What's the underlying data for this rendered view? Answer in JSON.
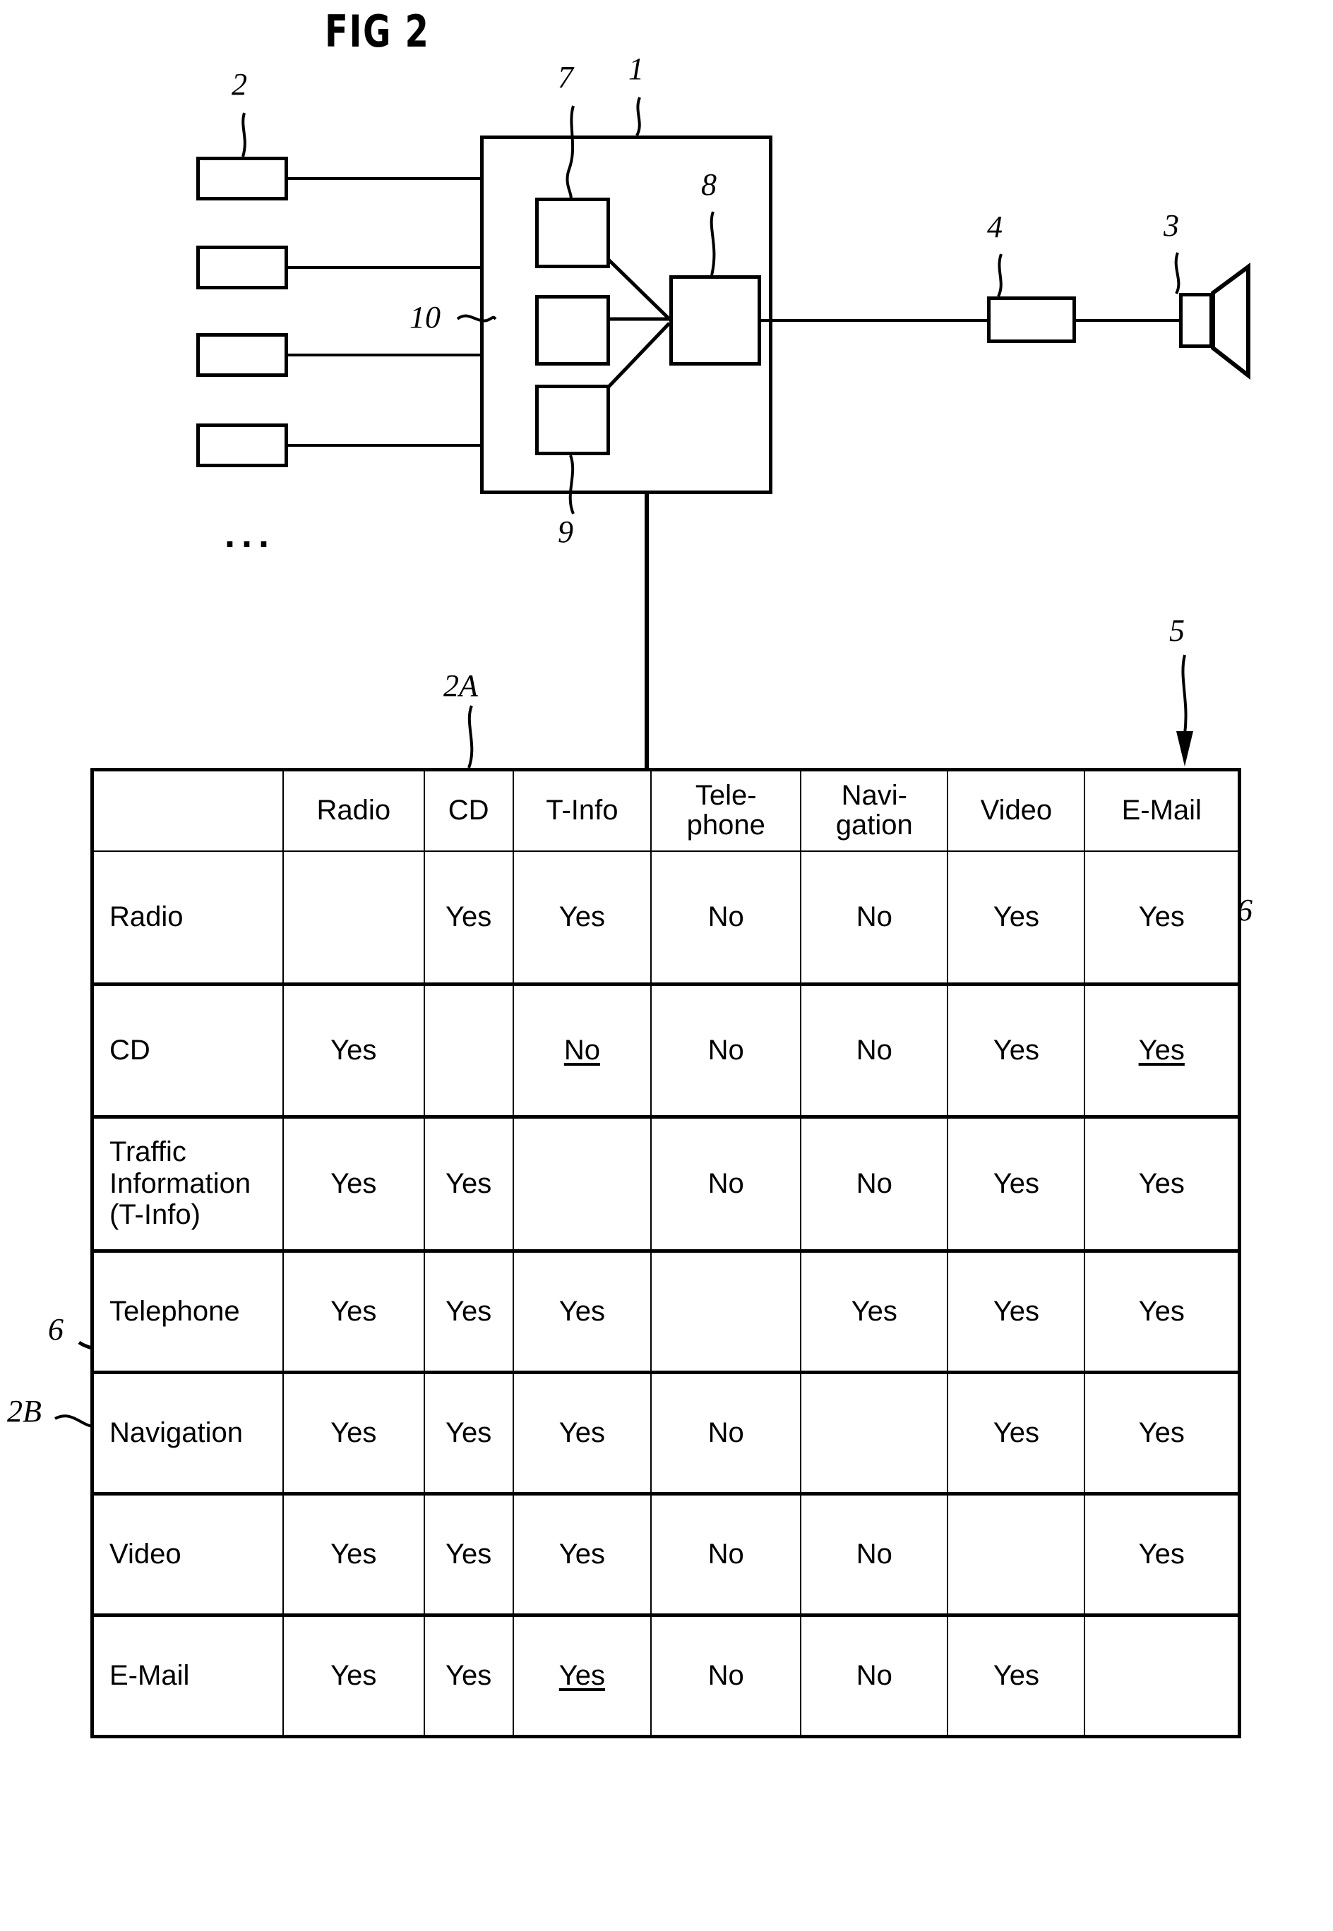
{
  "figure": {
    "title": "FIG 2",
    "ellipsis": "..."
  },
  "block_diagram": {
    "refs": {
      "sources": "2",
      "main_unit": "1",
      "decoder_top": "7",
      "mixer": "8",
      "decoder_bottom": "9",
      "bus": "10",
      "amplifier": "4",
      "loudspeaker": "3"
    },
    "source_boxes": [
      "",
      "",
      "",
      ""
    ],
    "inner_boxes": [
      "",
      "",
      ""
    ],
    "mixer_box": "",
    "amplifier_box": "",
    "speaker_box": ""
  },
  "matrix": {
    "refs": {
      "columns_group": "2A",
      "rows_group": "2B",
      "arrow_to_email": "5",
      "cell_note_radio_email": "6",
      "cell_note_telephone_cd": "6"
    },
    "corner_header": "",
    "columns": [
      "Radio",
      "CD",
      "T-Info",
      "Tele-\nphone",
      "Navi-\ngation",
      "Video",
      "E-Mail"
    ],
    "column_labels": {
      "radio": "Radio",
      "cd": "CD",
      "tinfo": "T-Info",
      "telephone_line1": "Tele-",
      "telephone_line2": "phone",
      "navigation_line1": "Navi-",
      "navigation_line2": "gation",
      "video": "Video",
      "email": "E-Mail"
    },
    "row_labels": {
      "radio": "Radio",
      "cd": "CD",
      "tinfo_line1": "Traffic",
      "tinfo_line2": "Information",
      "tinfo_line3": "(T-Info)",
      "telephone": "Telephone",
      "navigation": "Navigation",
      "video": "Video",
      "email": "E-Mail"
    },
    "rows": [
      {
        "label": "Radio",
        "cells": [
          {
            "v": ""
          },
          {
            "v": "Yes"
          },
          {
            "v": "Yes"
          },
          {
            "v": "No"
          },
          {
            "v": "No"
          },
          {
            "v": "Yes"
          },
          {
            "v": "Yes"
          }
        ]
      },
      {
        "label": "CD",
        "cells": [
          {
            "v": "Yes"
          },
          {
            "v": ""
          },
          {
            "v": "No",
            "underline": true
          },
          {
            "v": "No"
          },
          {
            "v": "No"
          },
          {
            "v": "Yes"
          },
          {
            "v": "Yes",
            "underline": true
          }
        ]
      },
      {
        "label": "Traffic Information (T-Info)",
        "cells": [
          {
            "v": "Yes"
          },
          {
            "v": "Yes"
          },
          {
            "v": ""
          },
          {
            "v": "No"
          },
          {
            "v": "No"
          },
          {
            "v": "Yes"
          },
          {
            "v": "Yes"
          }
        ]
      },
      {
        "label": "Telephone",
        "cells": [
          {
            "v": "Yes"
          },
          {
            "v": "Yes",
            "circled": true
          },
          {
            "v": "Yes"
          },
          {
            "v": ""
          },
          {
            "v": "Yes"
          },
          {
            "v": "Yes"
          },
          {
            "v": "Yes"
          }
        ]
      },
      {
        "label": "Navigation",
        "cells": [
          {
            "v": "Yes"
          },
          {
            "v": "Yes"
          },
          {
            "v": "Yes"
          },
          {
            "v": "No"
          },
          {
            "v": ""
          },
          {
            "v": "Yes"
          },
          {
            "v": "Yes"
          }
        ]
      },
      {
        "label": "Video",
        "cells": [
          {
            "v": "Yes"
          },
          {
            "v": "Yes"
          },
          {
            "v": "Yes"
          },
          {
            "v": "No"
          },
          {
            "v": "No"
          },
          {
            "v": ""
          },
          {
            "v": "Yes"
          }
        ]
      },
      {
        "label": "E-Mail",
        "cells": [
          {
            "v": "Yes"
          },
          {
            "v": "Yes"
          },
          {
            "v": "Yes",
            "underline": true
          },
          {
            "v": "No"
          },
          {
            "v": "No"
          },
          {
            "v": "Yes"
          },
          {
            "v": ""
          }
        ]
      }
    ],
    "cell_values": {
      "r1": [
        "",
        "Yes",
        "Yes",
        "No",
        "No",
        "Yes",
        "Yes"
      ],
      "r2": [
        "Yes",
        "",
        "No",
        "No",
        "No",
        "Yes",
        "Yes"
      ],
      "r3": [
        "Yes",
        "Yes",
        "",
        "No",
        "No",
        "Yes",
        "Yes"
      ],
      "r4": [
        "Yes",
        "Yes",
        "Yes",
        "",
        "Yes",
        "Yes",
        "Yes"
      ],
      "r5": [
        "Yes",
        "Yes",
        "Yes",
        "No",
        "",
        "Yes",
        "Yes"
      ],
      "r6": [
        "Yes",
        "Yes",
        "Yes",
        "No",
        "No",
        "",
        "Yes"
      ],
      "r7": [
        "Yes",
        "Yes",
        "Yes",
        "No",
        "No",
        "Yes",
        ""
      ]
    }
  },
  "colors": {
    "ink": "#000000",
    "paper": "#ffffff"
  }
}
